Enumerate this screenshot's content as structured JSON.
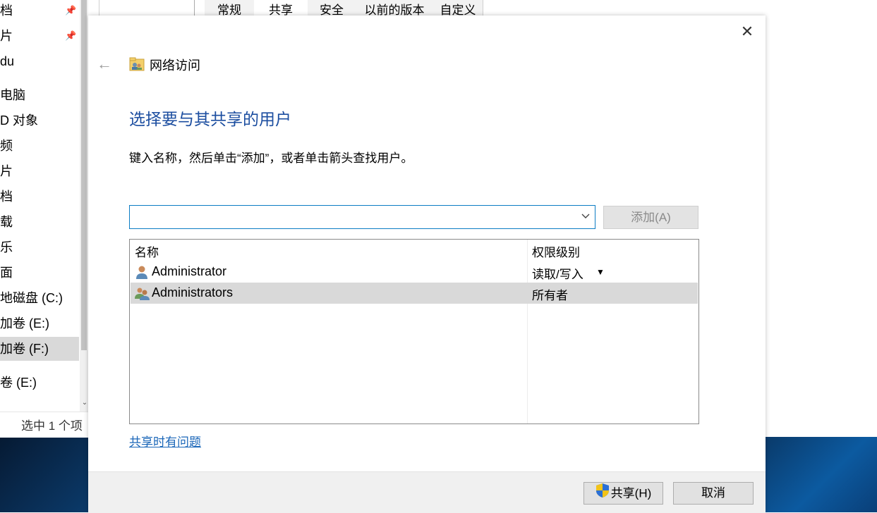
{
  "explorer": {
    "nav_items": [
      {
        "label": "档",
        "pinned": true
      },
      {
        "label": "片",
        "pinned": true
      },
      {
        "label": "du",
        "pinned": false
      },
      {
        "label": "电脑",
        "pinned": false
      },
      {
        "label": "D 对象",
        "pinned": false
      },
      {
        "label": "频",
        "pinned": false
      },
      {
        "label": "片",
        "pinned": false
      },
      {
        "label": "档",
        "pinned": false
      },
      {
        "label": "载",
        "pinned": false
      },
      {
        "label": "乐",
        "pinned": false
      },
      {
        "label": "面",
        "pinned": false
      },
      {
        "label": "地磁盘 (C:)",
        "pinned": false
      },
      {
        "label": "加卷 (E:)",
        "pinned": false
      },
      {
        "label": "加卷 (F:)",
        "pinned": false
      },
      {
        "label": "卷 (E:)",
        "pinned": false
      }
    ],
    "status": "选中 1 个项"
  },
  "properties": {
    "tabs": [
      "常规",
      "共享",
      "安全",
      "以前的版本",
      "自定义"
    ],
    "active_tab": "共享"
  },
  "dialog": {
    "header_title": "网络访问",
    "heading": "选择要与其共享的用户",
    "instruction": "键入名称，然后单击“添加”，或者单击箭头查找用户。",
    "name_input": {
      "value": "",
      "placeholder": ""
    },
    "add_label": "添加(A)",
    "columns": {
      "name": "名称",
      "permission": "权限级别"
    },
    "rows": [
      {
        "name": "Administrator",
        "permission": "读取/写入",
        "has_dropdown": true,
        "selected": false,
        "icon": "user-icon"
      },
      {
        "name": "Administrators",
        "permission": "所有者",
        "has_dropdown": false,
        "selected": true,
        "icon": "group-icon"
      }
    ],
    "help_link": "共享时有问题",
    "share_label": "共享(H)",
    "cancel_label": "取消"
  },
  "colors": {
    "heading": "#1c4ea0",
    "link": "#1a66b8",
    "input_border": "#0c7dc4",
    "selected_row": "#d9d9d9"
  }
}
